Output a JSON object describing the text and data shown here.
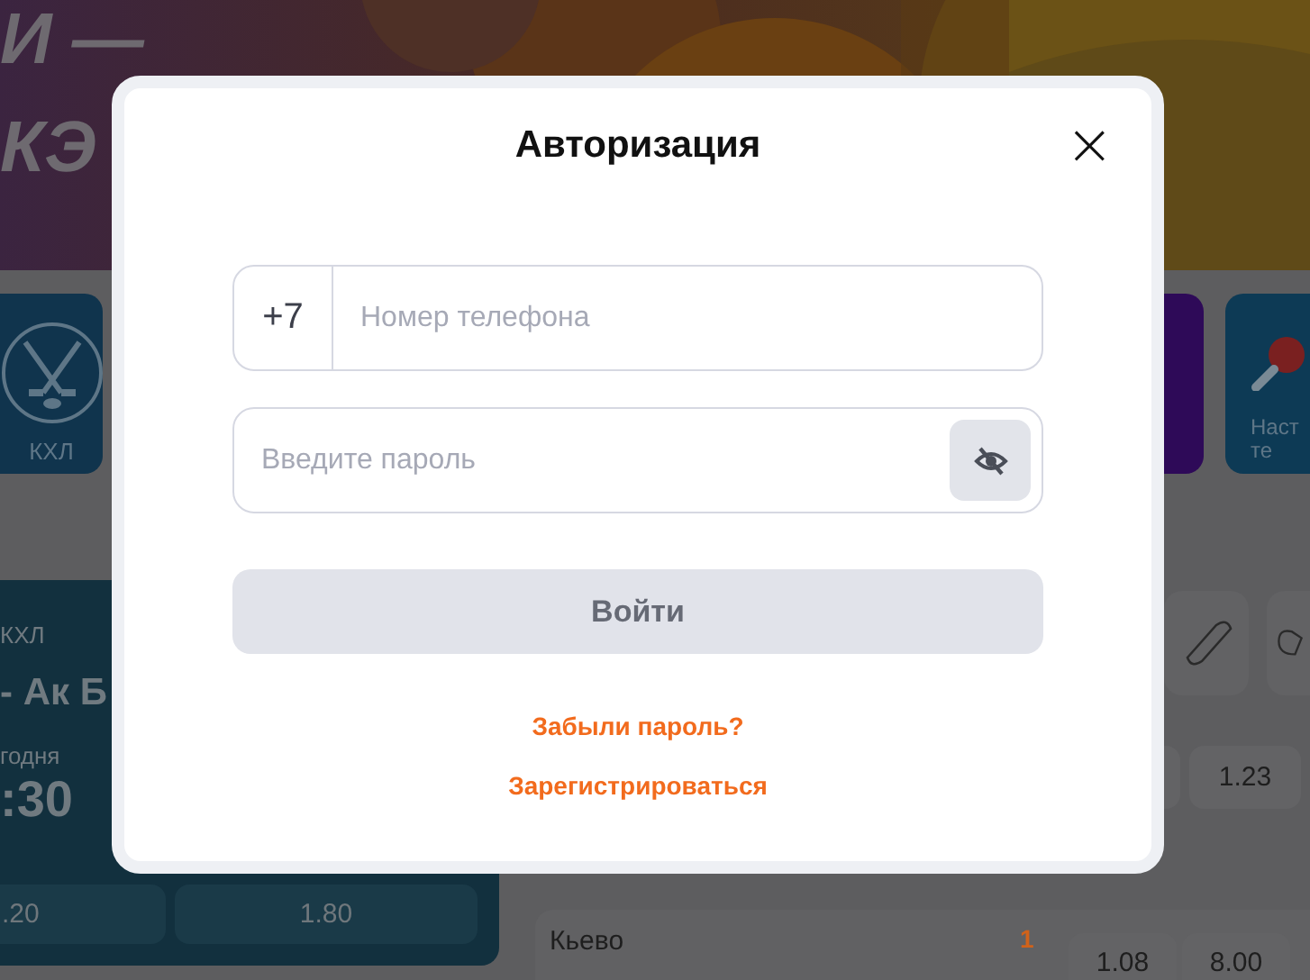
{
  "background": {
    "hero": {
      "lines": [
        "И —",
        "КЭ"
      ]
    },
    "sport_tiles": [
      {
        "kind": "hockey",
        "label_lines": [
          "КХЛ"
        ]
      },
      {
        "kind": "plain"
      },
      {
        "kind": "table_tennis",
        "label_lines": [
          "Наст",
          "те"
        ]
      }
    ],
    "featured_match": {
      "league": "КХЛ",
      "teams": "- Ак Б",
      "date": "годня",
      "time": ":30",
      "odds": [
        ".20",
        "1.80"
      ]
    },
    "odds_row": [
      "1.23"
    ],
    "match": {
      "team": "Кьево",
      "score": "1",
      "odds": [
        "1.08",
        "8.00"
      ]
    }
  },
  "modal": {
    "title": "Авторизация",
    "close": "×",
    "phone": {
      "prefix": "+7",
      "placeholder": "Номер телефона"
    },
    "password": {
      "placeholder": "Введите пароль",
      "visible": false
    },
    "login": {
      "label": "Войти",
      "disabled": true
    },
    "links": [
      "Забыли пароль?",
      "Зарегистрироваться"
    ]
  }
}
